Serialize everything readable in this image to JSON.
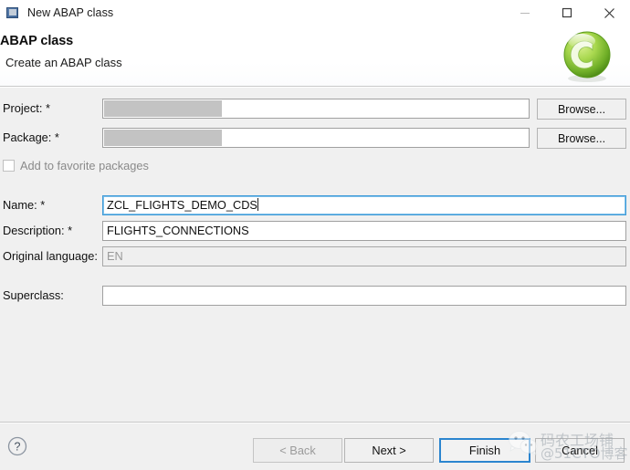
{
  "window": {
    "title": "New ABAP class",
    "icon": "abap-class-window-icon",
    "controls": {
      "minimize": "minimize-icon",
      "maximize": "maximize-icon",
      "close": "close-icon"
    }
  },
  "header": {
    "title": "ABAP class",
    "subtitle": "Create an ABAP class",
    "logo": "abap-class-green-c-logo"
  },
  "form": {
    "project": {
      "label": "Project: *",
      "value": "",
      "redacted": true,
      "browse_label": "Browse..."
    },
    "package": {
      "label": "Package: *",
      "value": "",
      "redacted": true,
      "browse_label": "Browse..."
    },
    "favorite": {
      "label": "Add to favorite packages",
      "checked": false
    },
    "name": {
      "label": "Name: *",
      "value": "ZCL_FLIGHTS_DEMO_CDS",
      "focused": true
    },
    "description": {
      "label": "Description: *",
      "value": "FLIGHTS_CONNECTIONS"
    },
    "original_language": {
      "label": "Original language:",
      "value": "EN",
      "disabled": true
    },
    "superclass": {
      "label": "Superclass:",
      "value": ""
    }
  },
  "footer": {
    "help_label": "?",
    "back_label": "< Back",
    "next_label": "Next >",
    "finish_label": "Finish",
    "cancel_label": "Cancel"
  },
  "watermark": {
    "line1": "码农工场铺",
    "line2": "@51CTO博客"
  },
  "colors": {
    "accent_focus": "#3f9bd8",
    "default_button_border": "#2b85cf",
    "dialog_background": "#f0f0f0",
    "header_background": "#ffffff",
    "logo_green": "#8cc63f",
    "redaction_gray": "#c3c3c3"
  }
}
